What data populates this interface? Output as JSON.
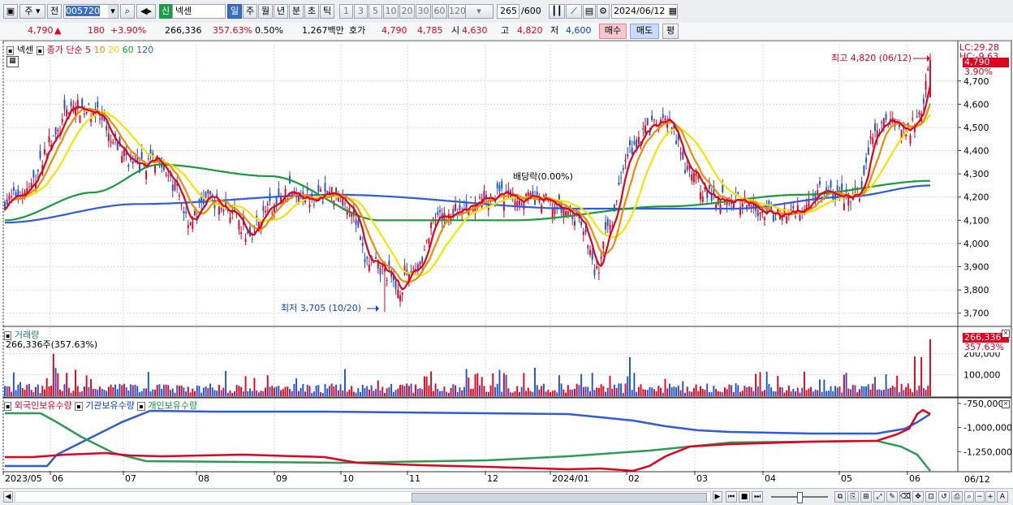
{
  "toolbar": {
    "period_mode": "주",
    "prev_label": "전",
    "code": "005720",
    "market_badge": "신",
    "stock_name": "넥센",
    "period_tabs": [
      "일",
      "주",
      "월",
      "년",
      "분",
      "초",
      "틱"
    ],
    "active_period": "일",
    "count_buttons": [
      "1",
      "3",
      "5",
      "10",
      "20",
      "30",
      "60",
      "120"
    ],
    "view_count": "265",
    "view_total": "/600",
    "date": "2024/06/12"
  },
  "quote": {
    "price": "4,790",
    "up_mark": "▲",
    "change": "180",
    "change_pct": "+3.90%",
    "volume": "266,336",
    "volume_ratio": "357.63%",
    "turnover_pct": "0.50%",
    "amount": "1,267백만",
    "hoga_label": "호가",
    "ask": "4,790",
    "bid": "4,785",
    "open_label": "시",
    "open": "4,630",
    "high_label": "고",
    "high": "4,820",
    "low_label": "저",
    "low": "4,600",
    "buy_button": "매수",
    "sell_button": "매도",
    "eval_button": "평"
  },
  "price_panel": {
    "stock_label": "넥센",
    "ma_label": "종가 단순",
    "ma_periods": [
      "5",
      "10",
      "20",
      "60",
      "120"
    ],
    "ma_colors": [
      "#e1001e",
      "#f08a00",
      "#f5e400",
      "#1a9a3a",
      "#2f5bd9"
    ],
    "lc_label": "LC:29.28",
    "hc_label": "HC:-9.63",
    "last_price_tag": "4,790",
    "last_change_tag": "3.90%",
    "high_annotation": "최고 4,820 (06/12)",
    "low_annotation": "최저 3,705 (10/20)",
    "dividend_annotation": "배당락(0.00%)",
    "y_ticks": [
      "4,700",
      "4,600",
      "4,500",
      "4,400",
      "4,300",
      "4,200",
      "4,100",
      "4,000",
      "3,900",
      "3,800",
      "3,700"
    ]
  },
  "volume_panel": {
    "title": "거래량",
    "value_label": "266,336주(357.63%)",
    "tag_value": "266,336",
    "tag_ratio": "357.63%",
    "y_ticks": [
      "200,000",
      "100,000"
    ]
  },
  "holding_panel": {
    "legend": [
      "외국인보유수량",
      "기관보유수량",
      "개인보유수량"
    ],
    "colors": [
      "#e1001e",
      "#2f5bd9",
      "#2e9a55"
    ],
    "y_ticks": [
      "-750,000",
      "-1,000,000",
      "-1,250,000"
    ]
  },
  "x_axis": {
    "labels": [
      "2023/05",
      "06",
      "07",
      "08",
      "09",
      "10",
      "11",
      "12",
      "2024/01",
      "02",
      "03",
      "04",
      "05",
      "06"
    ],
    "end_label": "06/12"
  },
  "chart_data": {
    "type": "candlestick",
    "y_range": [
      3650,
      4860
    ],
    "high_value": 4820,
    "low_value": 3705,
    "last_close": 4790,
    "volume_last": 266336,
    "volume_ratio_pct": 357.63,
    "change_pct": 3.9,
    "close_path_anchors": [
      [
        0,
        4180
      ],
      [
        10,
        4230
      ],
      [
        22,
        4450
      ],
      [
        30,
        4590
      ],
      [
        40,
        4570
      ],
      [
        50,
        4420
      ],
      [
        60,
        4330
      ],
      [
        70,
        4370
      ],
      [
        76,
        4250
      ],
      [
        84,
        4100
      ],
      [
        92,
        4200
      ],
      [
        100,
        4150
      ],
      [
        110,
        4040
      ],
      [
        120,
        4150
      ],
      [
        130,
        4230
      ],
      [
        140,
        4200
      ],
      [
        150,
        4220
      ],
      [
        156,
        4170
      ],
      [
        164,
        3920
      ],
      [
        172,
        3880
      ],
      [
        178,
        3805
      ],
      [
        186,
        3900
      ],
      [
        196,
        4100
      ],
      [
        206,
        4150
      ],
      [
        216,
        4200
      ],
      [
        226,
        4210
      ],
      [
        234,
        4200
      ],
      [
        244,
        4180
      ],
      [
        254,
        4140
      ],
      [
        260,
        4110
      ],
      [
        268,
        3880
      ],
      [
        274,
        4080
      ],
      [
        282,
        4400
      ],
      [
        292,
        4500
      ],
      [
        300,
        4520
      ],
      [
        310,
        4300
      ],
      [
        320,
        4200
      ],
      [
        330,
        4200
      ],
      [
        340,
        4150
      ],
      [
        350,
        4120
      ],
      [
        360,
        4150
      ],
      [
        370,
        4230
      ],
      [
        378,
        4200
      ],
      [
        386,
        4200
      ],
      [
        394,
        4480
      ],
      [
        402,
        4540
      ],
      [
        408,
        4480
      ],
      [
        414,
        4550
      ],
      [
        419,
        4790
      ]
    ],
    "ma120_anchors": [
      [
        0,
        4090
      ],
      [
        60,
        4170
      ],
      [
        150,
        4210
      ],
      [
        260,
        4150
      ],
      [
        330,
        4150
      ],
      [
        380,
        4200
      ],
      [
        419,
        4250
      ]
    ],
    "ma60_anchors": [
      [
        0,
        4100
      ],
      [
        40,
        4220
      ],
      [
        70,
        4340
      ],
      [
        120,
        4290
      ],
      [
        170,
        4100
      ],
      [
        230,
        4100
      ],
      [
        300,
        4160
      ],
      [
        360,
        4210
      ],
      [
        419,
        4270
      ]
    ]
  }
}
